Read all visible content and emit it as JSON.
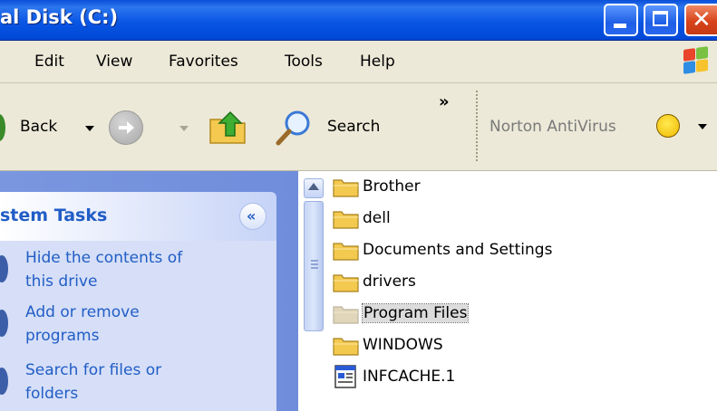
{
  "window": {
    "title": "al Disk (C:)"
  },
  "menu": [
    "Edit",
    "View",
    "Favorites",
    "Tools",
    "Help"
  ],
  "toolbar": {
    "back_label": "Back",
    "search_label": "Search",
    "overflow": "»",
    "norton_label": "Norton AntiVirus"
  },
  "task_pane": {
    "header": "stem Tasks",
    "collapse_glyph": "«",
    "items": [
      {
        "line1": "Hide the contents of",
        "line2": "this drive"
      },
      {
        "line1": "Add or remove",
        "line2": "programs"
      },
      {
        "line1": "Search for files or",
        "line2": "folders"
      }
    ]
  },
  "files": [
    {
      "name": "Brother",
      "type": "folder"
    },
    {
      "name": "dell",
      "type": "folder"
    },
    {
      "name": "Documents and Settings",
      "type": "folder"
    },
    {
      "name": "drivers",
      "type": "folder"
    },
    {
      "name": "Program Files",
      "type": "folder",
      "selected": true
    },
    {
      "name": "WINDOWS",
      "type": "folder"
    },
    {
      "name": "INFCACHE.1",
      "type": "file"
    }
  ],
  "colors": {
    "titlebar": "#0a56e4",
    "taskpane_text": "#215dc6",
    "folder": "#f3c94f"
  }
}
